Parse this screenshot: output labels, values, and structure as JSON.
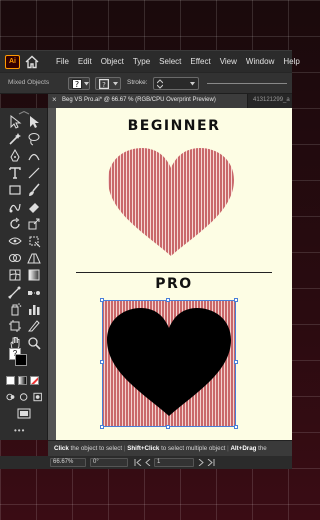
{
  "app": {
    "logo_text": "Ai",
    "menu": [
      "File",
      "Edit",
      "Object",
      "Type",
      "Select",
      "Effect",
      "View",
      "Window",
      "Help"
    ]
  },
  "control_bar": {
    "selection_label": "Mixed Objects",
    "stroke_label": "Stroke:"
  },
  "tabs": {
    "active_close": "×",
    "active_title": "Beg VS Pro.ai* @ 66.67 % (RGB/CPU Overprint Preview)",
    "second_title": "413121299_a"
  },
  "artboard": {
    "beginner_label": "BEGINNER",
    "pro_label": "PRO",
    "colors": {
      "stripe_red": "#c9686a",
      "stripe_light": "#f3d3cf",
      "heart_fill": "#000000",
      "paper": "#fdfde4",
      "selection": "#4a7fd8"
    }
  },
  "tools": {
    "question_mark": "?",
    "more": "•••",
    "icons": [
      "selection-arrow-icon",
      "direct-selection-icon",
      "magic-wand-icon",
      "lasso-icon",
      "pen-icon",
      "curvature-icon",
      "type-icon",
      "line-icon",
      "rectangle-icon",
      "paintbrush-icon",
      "shaper-icon",
      "eraser-icon",
      "rotate-icon",
      "scale-icon",
      "width-icon",
      "free-transform-icon",
      "shape-builder-icon",
      "perspective-icon",
      "mesh-icon",
      "gradient-icon",
      "eyedropper-icon",
      "blend-icon",
      "symbol-sprayer-icon",
      "column-graph-icon",
      "artboard-icon",
      "slice-icon",
      "hand-icon",
      "zoom-icon"
    ]
  },
  "hint_bar": {
    "part1_key": "Click",
    "part1_text": " the object to select",
    "part2_key": "Shift+Click",
    "part2_text": " to select multiple object",
    "part3_key": "Alt+Drag",
    "part3_text": " the"
  },
  "status_bar": {
    "zoom": "66.67%",
    "rotation": "0°",
    "artboard_number": "1"
  }
}
